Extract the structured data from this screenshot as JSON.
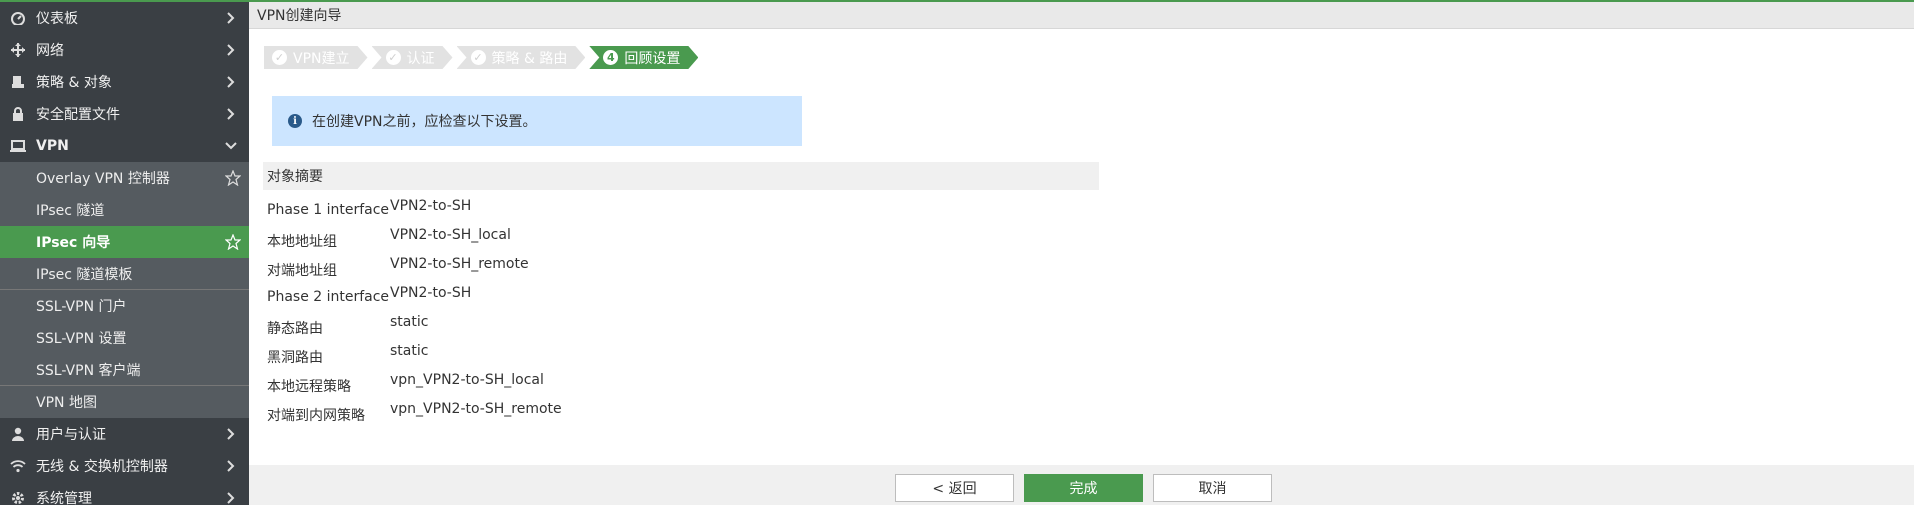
{
  "colors": {
    "accent": "#4a9a4f",
    "sidebar_bg": "#3a3f44",
    "sub_bg": "#555b60",
    "info_bg": "#cce5ff"
  },
  "sidebar": {
    "items": [
      {
        "label": "仪表板",
        "icon": "dashboard-icon"
      },
      {
        "label": "网络",
        "icon": "network-icon"
      },
      {
        "label": "策略 & 对象",
        "icon": "policy-icon"
      },
      {
        "label": "安全配置文件",
        "icon": "lock-icon"
      },
      {
        "label": "VPN",
        "icon": "laptop-icon"
      }
    ],
    "vpn_sub": [
      {
        "label": "Overlay VPN 控制器"
      },
      {
        "label": "IPsec 隧道"
      },
      {
        "label": "IPsec 向导"
      },
      {
        "label": "IPsec 隧道模板"
      },
      {
        "label": "SSL-VPN 门户"
      },
      {
        "label": "SSL-VPN 设置"
      },
      {
        "label": "SSL-VPN 客户端"
      },
      {
        "label": "VPN 地图"
      }
    ],
    "after": [
      {
        "label": "用户与认证",
        "icon": "user-icon"
      },
      {
        "label": "无线 & 交换机控制器",
        "icon": "wifi-icon"
      },
      {
        "label": "系统管理",
        "icon": "gear-icon"
      }
    ]
  },
  "header": {
    "title": "VPN创建向导"
  },
  "steps": [
    {
      "label": "VPN建立",
      "mark": "✓"
    },
    {
      "label": "认证",
      "mark": "✓"
    },
    {
      "label": "策略 & 路由",
      "mark": "✓"
    },
    {
      "label": "回顾设置",
      "mark": "4"
    }
  ],
  "info": {
    "text": "在创建VPN之前，应检查以下设置。"
  },
  "summary": {
    "title": "对象摘要",
    "rows": [
      {
        "key": "Phase 1 interface",
        "value": "VPN2-to-SH"
      },
      {
        "key": "本地地址组",
        "value": "VPN2-to-SH_local"
      },
      {
        "key": "对端地址组",
        "value": "VPN2-to-SH_remote"
      },
      {
        "key": "Phase 2 interface",
        "value": "VPN2-to-SH"
      },
      {
        "key": "静态路由",
        "value": "static"
      },
      {
        "key": "黑洞路由",
        "value": "static"
      },
      {
        "key": "本地远程策略",
        "value": "vpn_VPN2-to-SH_local"
      },
      {
        "key": "对端到内网策略",
        "value": "vpn_VPN2-to-SH_remote"
      }
    ]
  },
  "footer": {
    "back": "< 返回",
    "done": "完成",
    "cancel": "取消"
  }
}
